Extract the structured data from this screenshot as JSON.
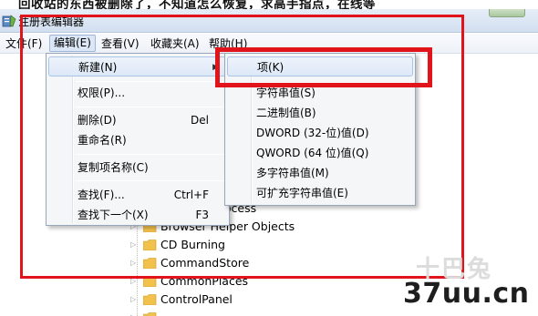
{
  "forum_title": "回收站的东西被删除了，不知道怎么恢复，求高手指点，在线等",
  "window": {
    "title": "注册表编辑器"
  },
  "menubar": {
    "file": "文件(F)",
    "edit": "编辑(E)",
    "view": "查看(V)",
    "favorites": "收藏夹(A)",
    "help": "帮助(H)"
  },
  "edit_menu": {
    "new": "新建(N)",
    "permissions": "权限(P)...",
    "delete": "删除(D)",
    "delete_key": "Del",
    "rename": "重命名(R)",
    "copy_key_name": "复制项名称(C)",
    "find": "查找(F)...",
    "find_key": "Ctrl+F",
    "find_next": "查找下一个(X)",
    "find_next_key": "F3"
  },
  "new_submenu": {
    "key": "项(K)",
    "string_value": "字符串值(S)",
    "binary_value": "二进制值(B)",
    "dword_value": "DWORD (32-位)值(D)",
    "qword_value": "QWORD (64 位)值(Q)",
    "multi_string_value": "多字符串值(M)",
    "expandable_string_value": "可扩充字符串值(E)"
  },
  "tree": {
    "partial_item": "rocess",
    "items": [
      "Browser Helper Objects",
      "CD Burning",
      "CommandStore",
      "CommonPlaces",
      "ControlPanel"
    ]
  },
  "annotations": {
    "color": "#e0141a"
  },
  "watermark": {
    "site_cn": "十巴兔",
    "url": "37uu.cn"
  }
}
